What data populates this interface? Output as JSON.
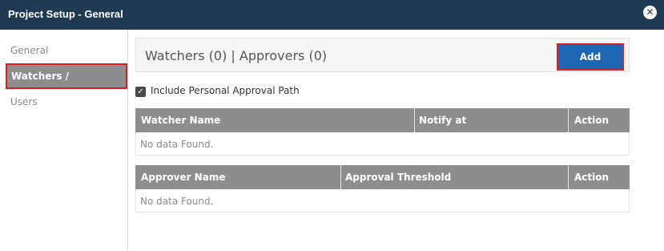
{
  "window": {
    "title": "Project Setup - General"
  },
  "sidebar": {
    "items": [
      {
        "label": "General"
      },
      {
        "label": "Watchers / Approvers"
      },
      {
        "label": "Users"
      }
    ]
  },
  "panel": {
    "title": "Watchers (0) | Approvers (0)",
    "add_label": "Add"
  },
  "options": {
    "include_personal_label": "Include Personal Approval Path",
    "include_personal_checked": true
  },
  "watchers_table": {
    "columns": [
      "Watcher Name",
      "Notify at",
      "Action"
    ],
    "empty_text": "No data Found."
  },
  "approvers_table": {
    "columns": [
      "Approver Name",
      "Approval Threshold",
      "Action"
    ],
    "empty_text": "No data Found."
  },
  "colors": {
    "titlebar": "#1f3a52",
    "accent_button": "#1d66b3",
    "highlight_border": "#d6202a",
    "table_header": "#8d8d8d"
  }
}
